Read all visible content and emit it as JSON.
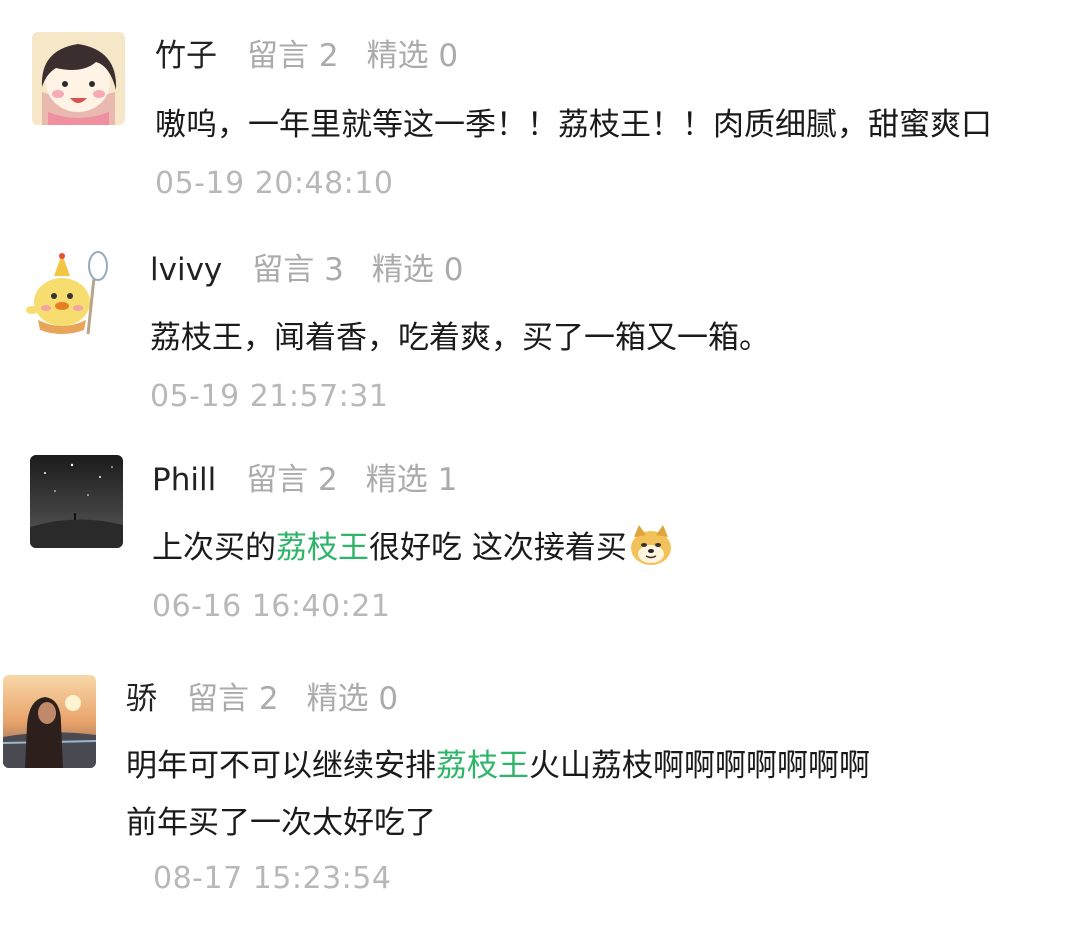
{
  "comments": [
    {
      "name": "竹子",
      "replies_label": "留言 2",
      "featured_label": "精选 0",
      "text_lines": [
        "嗷呜，一年里就等这一季！！荔枝王！！肉质细腻，甜蜜爽口"
      ],
      "time": "05-19 20:48:10",
      "avatar_icon": "cartoon-girl-avatar-icon"
    },
    {
      "name": "lvivy",
      "replies_label": "留言 3",
      "featured_label": "精选 0",
      "text_lines": [
        "荔枝王，闻着香，吃着爽，买了一箱又一箱。"
      ],
      "time": "05-19 21:57:31",
      "avatar_icon": "cartoon-chick-with-spoon-avatar-icon"
    },
    {
      "name": "Phill",
      "replies_label": "留言 2",
      "featured_label": "精选 1",
      "text_prefix": "上次买的",
      "text_keyword": "荔枝王",
      "text_suffix": "很好吃 这次接着买",
      "emoji": "doge-emoji-icon",
      "time": "06-16 16:40:21",
      "avatar_icon": "night-sky-avatar-icon"
    },
    {
      "name": "骄",
      "replies_label": "留言 2",
      "featured_label": "精选 0",
      "text_prefix": "明年可不可以继续安排",
      "text_keyword": "荔枝王",
      "text_suffix": "火山荔枝啊啊啊啊啊啊啊",
      "text_line2": "前年买了一次太好吃了",
      "time": "08-17 15:23:54",
      "avatar_icon": "sunset-portrait-avatar-icon"
    }
  ],
  "colors": {
    "keyword": "#2fb56a",
    "meta_gray": "#ababab",
    "time_gray": "#b8b8b8"
  }
}
